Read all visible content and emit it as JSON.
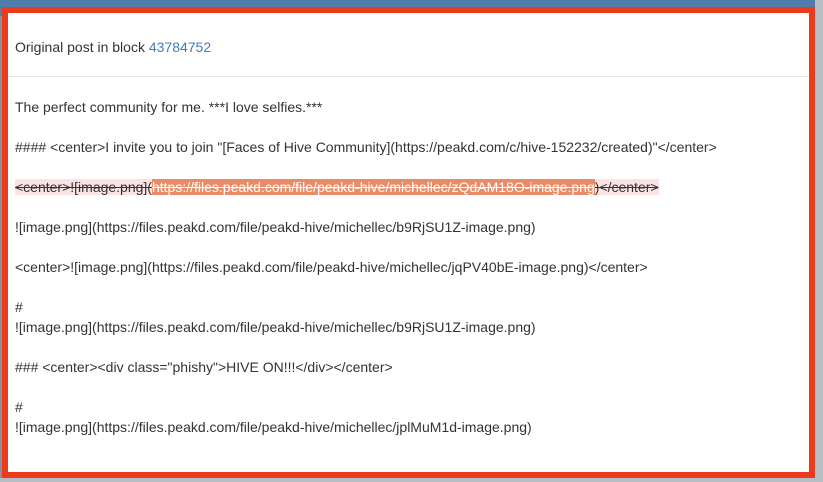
{
  "header": {
    "prefix": "Original post in block",
    "block_number": "43784752"
  },
  "content": {
    "line1": "The perfect community for me. ***I love selfies.***",
    "line2": "#### <center>I invite you to join \"[Faces of Hive Community](https://peakd.com/c/hive-152232/created)\"</center>",
    "line3_before": "<center>![image.png](",
    "line3_highlight": "https://files.peakd.com/file/peakd-hive/michellec/zQdAM18O-image.png",
    "line3_after": ")</center>",
    "line4": "![image.png](https://files.peakd.com/file/peakd-hive/michellec/b9RjSU1Z-image.png)",
    "line5": "<center>![image.png](https://files.peakd.com/file/peakd-hive/michellec/jqPV40bE-image.png)</center>",
    "line6a": "#",
    "line6b": "![image.png](https://files.peakd.com/file/peakd-hive/michellec/b9RjSU1Z-image.png)",
    "line7": "### <center><div class=\"phishy\">HIVE ON!!!</div></center>",
    "line8a": "#",
    "line8b": "![image.png](https://files.peakd.com/file/peakd-hive/michellec/jplMuM1d-image.png)"
  },
  "colors": {
    "highlight_border": "#ec3b1c",
    "link": "#3f7fb8",
    "deleted_bg": "#fbe3e3",
    "deleted_highlight": "#e98b67"
  }
}
